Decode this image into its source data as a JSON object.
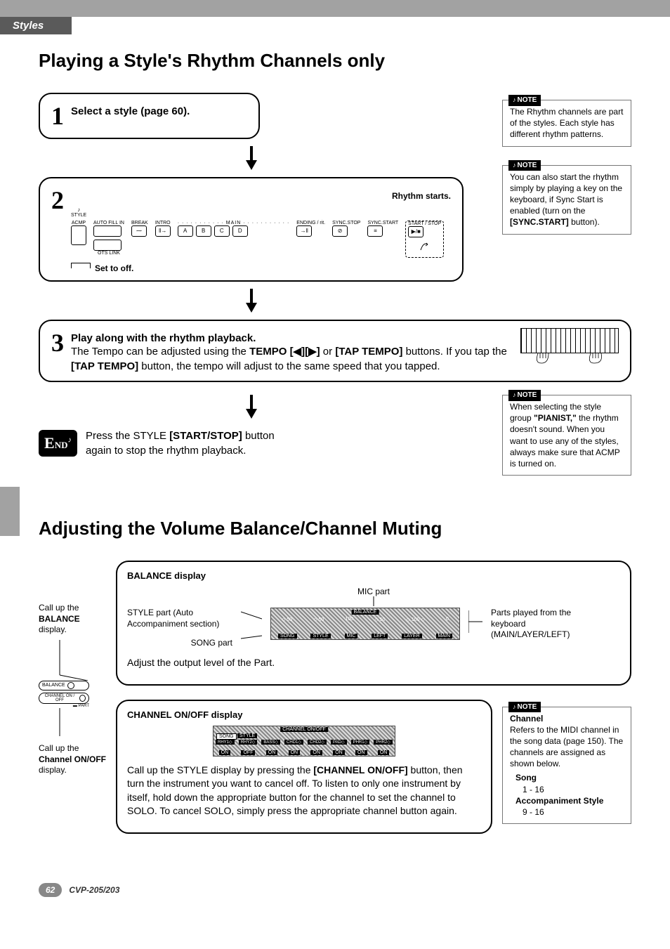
{
  "header": {
    "section": "Styles"
  },
  "heading1": "Playing a Style's Rhythm Channels only",
  "step1": {
    "text": "Select a style (page 60)."
  },
  "step2": {
    "rhythm_starts": "Rhythm starts.",
    "set_off": "Set to off.",
    "panel": {
      "style_icon": "STYLE",
      "acmp": "ACMP",
      "auto_fillin": "AUTO FILL IN",
      "break": "BREAK",
      "intro": "INTRO",
      "main": "MAIN",
      "ending": "ENDING / rit.",
      "sync_stop": "SYNC.STOP",
      "sync_start": "SYNC.START",
      "start_stop": "START / STOP",
      "ots_link": "OTS LINK",
      "a": "A",
      "b": "B",
      "c": "C",
      "d": "D"
    }
  },
  "step3": {
    "title": "Play along with the rhythm playback.",
    "line1_a": "The Tempo can be adjusted using the ",
    "line1_b": "TEMPO [◀][▶]",
    "line1_c": " or ",
    "line1_d": "[TAP TEMPO]",
    "line1_e": " buttons. If you tap the ",
    "line1_f": "[TAP TEMPO]",
    "line1_g": " button, the tempo will adjust to the same speed that you tapped."
  },
  "end": {
    "label": "END",
    "text_a": "Press the STYLE ",
    "text_b": "[START/STOP]",
    "text_c": " button again to stop the rhythm playback."
  },
  "notes": {
    "n1": "The Rhythm channels are part of the styles. Each style has different rhythm patterns.",
    "n2_a": "You can also start the rhythm simply by playing a key on the keyboard, if Sync Start is enabled (turn on the ",
    "n2_b": "[SYNC.START]",
    "n2_c": " button).",
    "n3_a": "When selecting the style group ",
    "n3_b": "\"PIANIST,\"",
    "n3_c": " the rhythm doesn't sound. When you want to use any of the styles, always make sure that ACMP is turned on.",
    "note_label": "NOTE"
  },
  "heading2": "Adjusting the Volume Balance/Channel Muting",
  "balance": {
    "title": "BALANCE display",
    "mic": "MIC part",
    "style_part_a": "STYLE part (Auto Accompaniment section)",
    "song_part": "SONG part",
    "kbd_parts": "Parts played from the keyboard (MAIN/LAYER/LEFT)",
    "adjust": "Adjust the output level of the Part.",
    "call_balance_a": "Call up the ",
    "call_balance_b": "BALANCE",
    "call_balance_c": " display.",
    "call_ch_a": "Call up the ",
    "call_ch_b": "Channel ON/OFF",
    "call_ch_c": " display.",
    "screen_labels": {
      "balance": "BALANCE",
      "song": "SONG",
      "style": "STYLE",
      "mic": "MIC",
      "left": "LEFT",
      "layer": "LAYER",
      "main": "MAIN",
      "v50": "50",
      "v100": "100",
      "v0": "0"
    }
  },
  "channel": {
    "title": "CHANNEL ON/OFF display",
    "text_a": "Call up the STYLE display by pressing the ",
    "text_b": "[CHANNEL ON/OFF]",
    "text_c": " button, then turn the instrument you want to cancel off. To listen to only one instrument by itself, hold down the appropriate button for the channel to set the channel to SOLO. To cancel SOLO, simply press the appropriate channel button again.",
    "screen_labels": {
      "title": "CHANNEL ON/OFF",
      "song": "SONG",
      "style": "STYLE",
      "rhy1": "RHY1",
      "rhy2": "RHY2",
      "bass": "BASS",
      "chd1": "CHD1",
      "chd2": "CHD2",
      "pad": "PAD",
      "phr1": "PHR1",
      "phr2": "PHR2",
      "on": "ON",
      "off": "OFF"
    }
  },
  "note_channel": {
    "title": "Channel",
    "text": "Refers to the MIDI channel in the song data (page 150). The channels are assigned as shown below.",
    "song": "Song",
    "song_range": "1 - 16",
    "acc": "Accompaniment Style",
    "acc_range": "9 - 16"
  },
  "side_labels": {
    "balance_btn": "BALANCE",
    "channel_btn": "CHANNEL ON / OFF",
    "part": "PART"
  },
  "footer": {
    "page": "62",
    "model": "CVP-205/203"
  }
}
